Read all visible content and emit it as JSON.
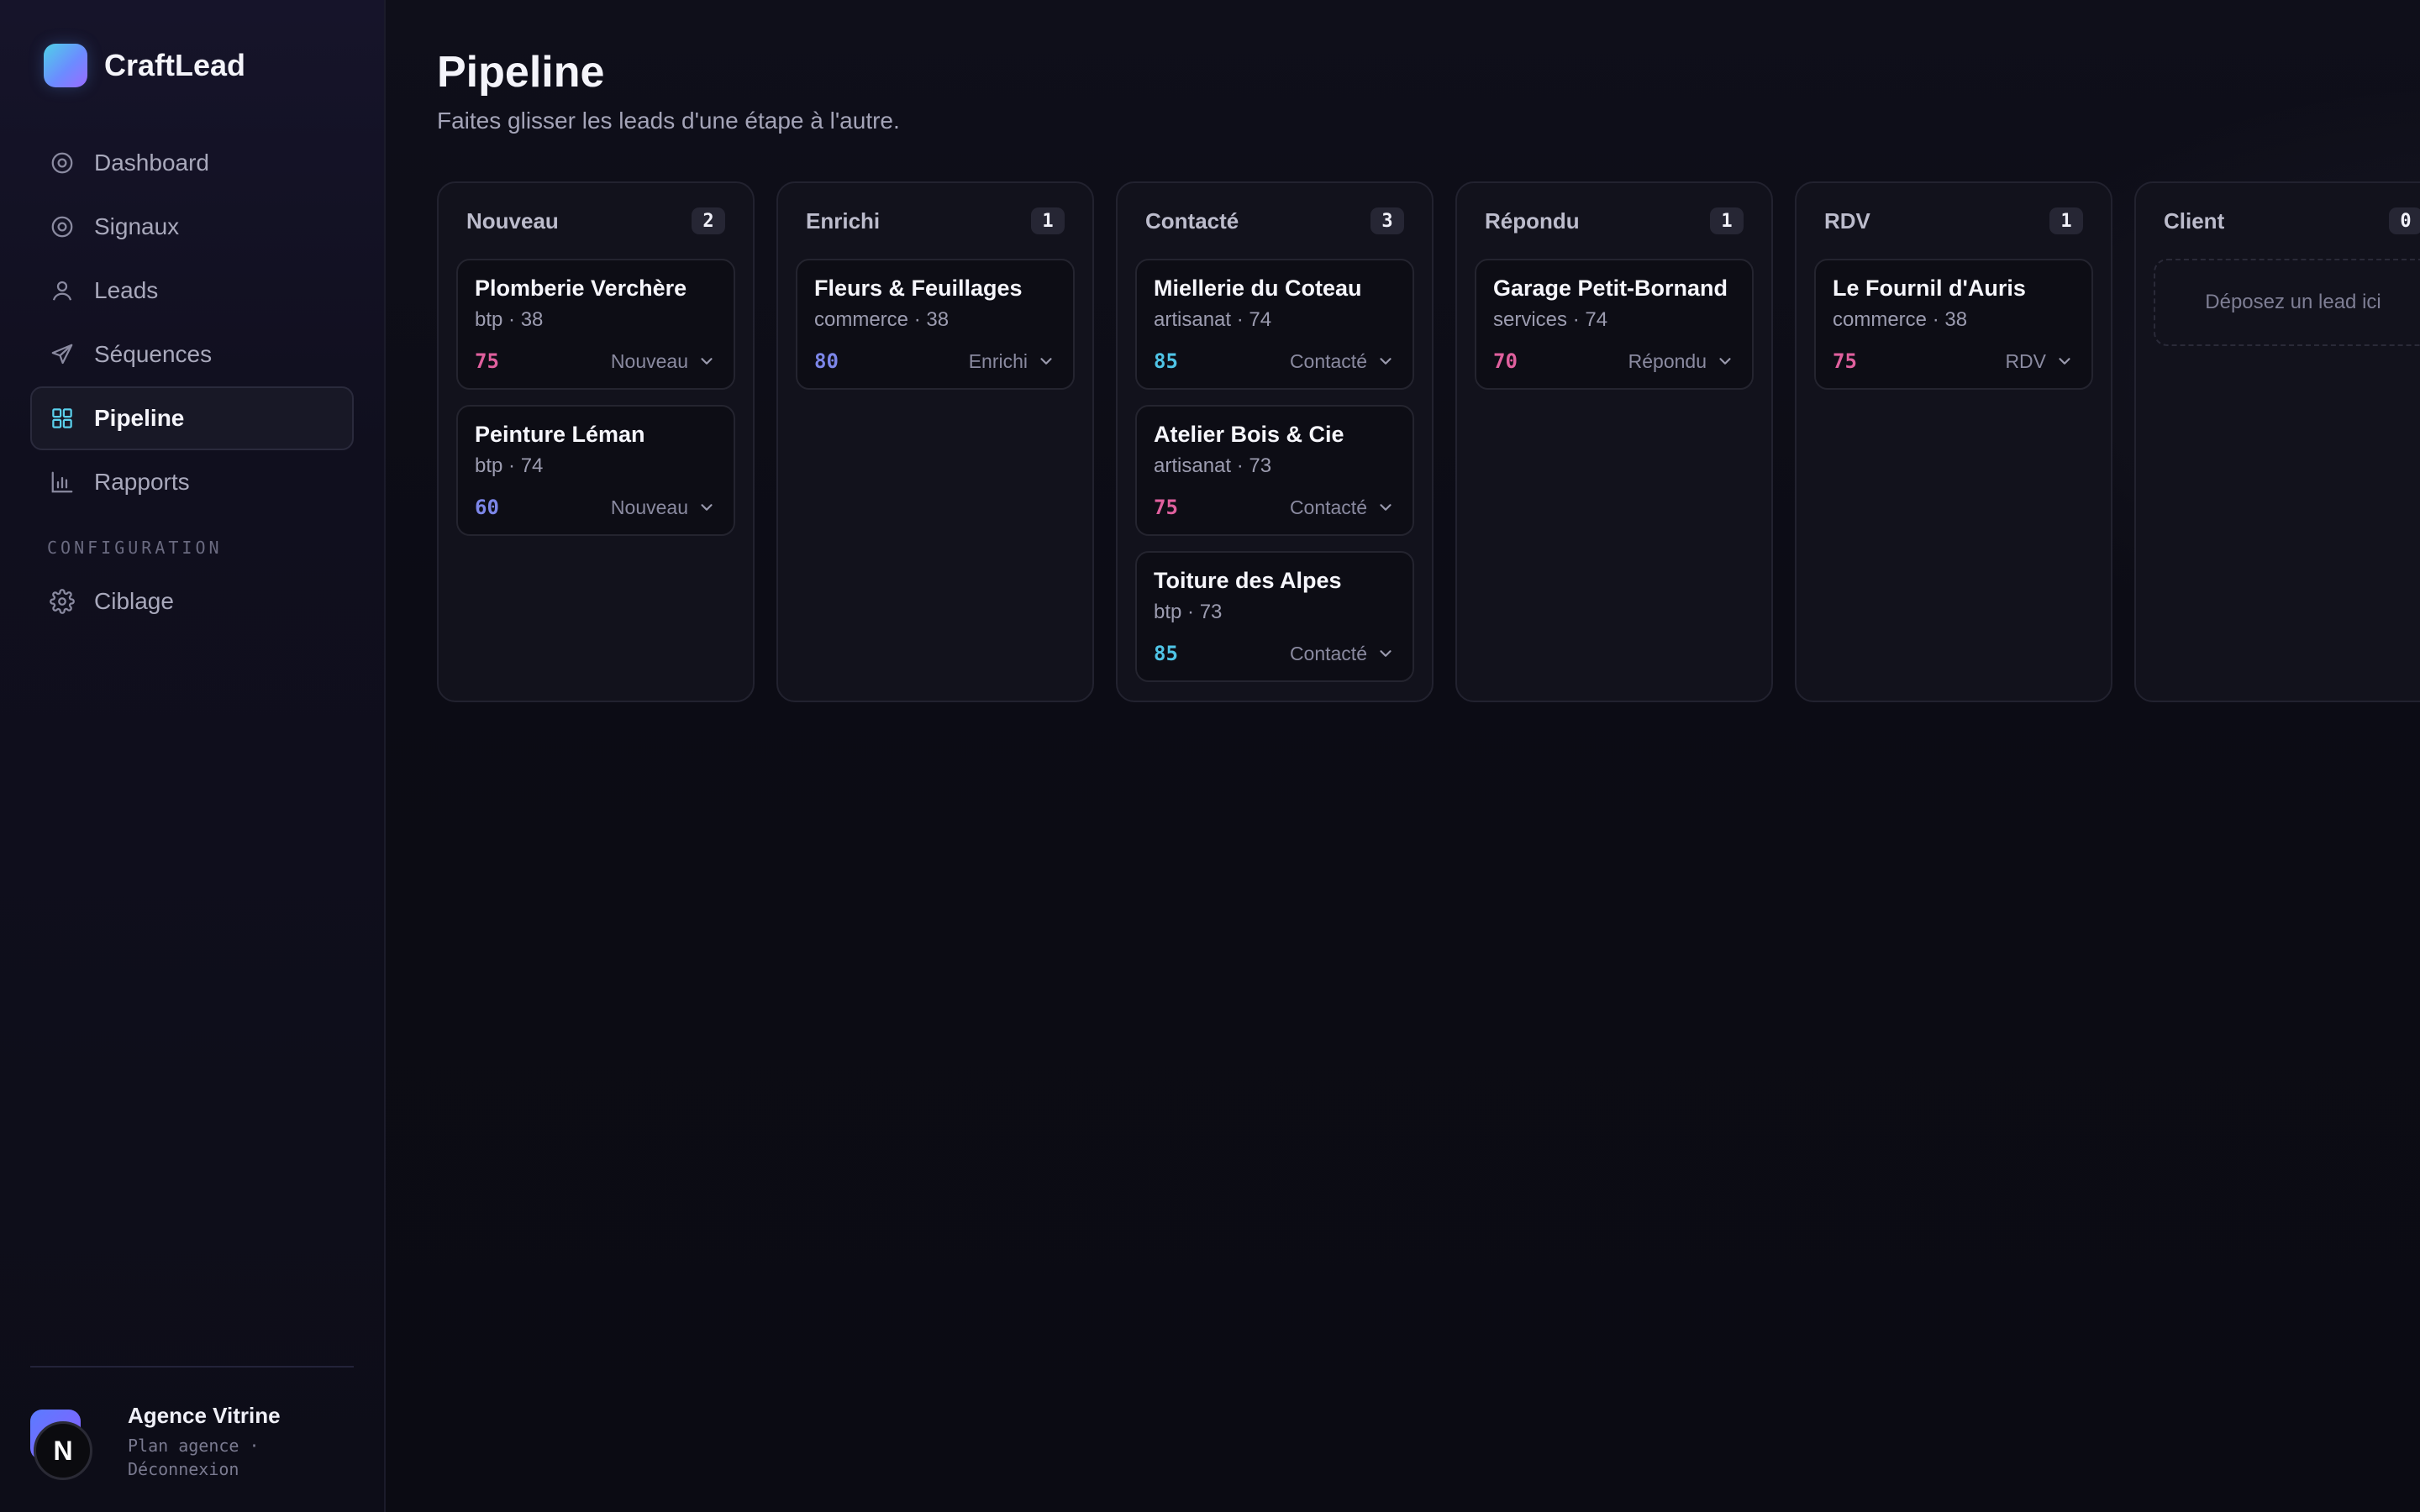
{
  "app": {
    "name": "CraftLead"
  },
  "sidebar": {
    "items": [
      {
        "label": "Dashboard",
        "icon": "dashboard-icon"
      },
      {
        "label": "Signaux",
        "icon": "signal-icon"
      },
      {
        "label": "Leads",
        "icon": "user-icon"
      },
      {
        "label": "Séquences",
        "icon": "send-icon"
      },
      {
        "label": "Pipeline",
        "icon": "grid-icon",
        "active": true
      },
      {
        "label": "Rapports",
        "icon": "bar-chart-icon"
      }
    ],
    "section_label": "CONFIGURATION",
    "config_items": [
      {
        "label": "Ciblage",
        "icon": "gear-icon"
      }
    ],
    "account": {
      "name": "Agence Vitrine",
      "subtitle": "Plan agence · Déconnexion",
      "avatar_letter": "N"
    }
  },
  "page": {
    "title": "Pipeline",
    "subtitle": "Faites glisser les leads d'une étape à l'autre."
  },
  "score_colors": {
    "pink": "#e0609e",
    "cyan": "#4fc4e6",
    "indigo": "#7c86e8"
  },
  "columns": [
    {
      "title": "Nouveau",
      "count": "2",
      "cards": [
        {
          "name": "Plomberie Verchère",
          "meta": "btp · 38",
          "score": "75",
          "score_color": "#e0609e",
          "stage": "Nouveau"
        },
        {
          "name": "Peinture Léman",
          "meta": "btp · 74",
          "score": "60",
          "score_color": "#7c86e8",
          "stage": "Nouveau"
        }
      ]
    },
    {
      "title": "Enrichi",
      "count": "1",
      "cards": [
        {
          "name": "Fleurs & Feuillages",
          "meta": "commerce · 38",
          "score": "80",
          "score_color": "#7c86e8",
          "stage": "Enrichi"
        }
      ]
    },
    {
      "title": "Contacté",
      "count": "3",
      "cards": [
        {
          "name": "Miellerie du Coteau",
          "meta": "artisanat · 74",
          "score": "85",
          "score_color": "#4fc4e6",
          "stage": "Contacté"
        },
        {
          "name": "Atelier Bois & Cie",
          "meta": "artisanat · 73",
          "score": "75",
          "score_color": "#e0609e",
          "stage": "Contacté"
        },
        {
          "name": "Toiture des Alpes",
          "meta": "btp · 73",
          "score": "85",
          "score_color": "#4fc4e6",
          "stage": "Contacté"
        }
      ]
    },
    {
      "title": "Répondu",
      "count": "1",
      "cards": [
        {
          "name": "Garage Petit-Bornand",
          "meta": "services · 74",
          "score": "70",
          "score_color": "#e0609e",
          "stage": "Répondu"
        }
      ]
    },
    {
      "title": "RDV",
      "count": "1",
      "cards": [
        {
          "name": "Le Fournil d'Auris",
          "meta": "commerce · 38",
          "score": "75",
          "score_color": "#e0609e",
          "stage": "RDV"
        }
      ]
    },
    {
      "title": "Client",
      "count": "0",
      "cards": [],
      "empty_label": "Déposez un lead ici"
    }
  ]
}
